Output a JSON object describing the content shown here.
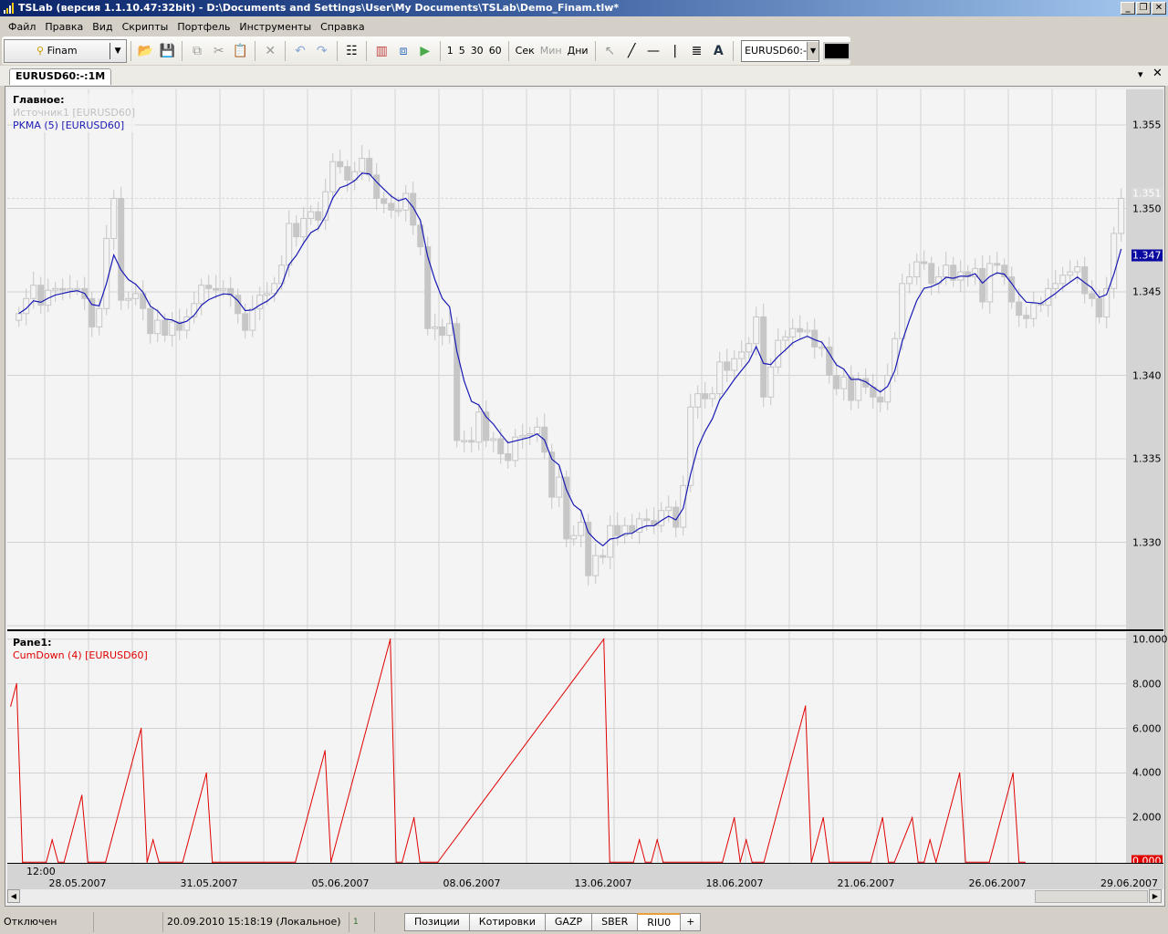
{
  "window": {
    "title": "TSLab (версия 1.1.10.47:32bit) - D:\\Documents and Settings\\User\\My Documents\\TSLab\\Demo_Finam.tlw*"
  },
  "menu": [
    "Файл",
    "Правка",
    "Вид",
    "Скрипты",
    "Портфель",
    "Инструменты",
    "Справка"
  ],
  "toolbar": {
    "provider": "Finam",
    "intervals": [
      "1",
      "5",
      "30",
      "60"
    ],
    "units": [
      "Сек",
      "Мин",
      "Дни"
    ],
    "symbol": "EURUSD60:-",
    "color": "#000000"
  },
  "chart_tab": "EURUSD60:-:1M",
  "main_pane": {
    "title": "Главное:",
    "source_label": "Источник1 [EURUSD60]",
    "indicator_label": "PKMA (5) [EURUSD60]",
    "last_price_label": "1.351",
    "indicator_value_label": "1.347"
  },
  "lower_pane": {
    "title": "Pane1:",
    "indicator_label": "CumDown (4) [EURUSD60]",
    "last_value_label": "0.000"
  },
  "time_axis": {
    "time_label": "12:00",
    "dates": [
      "28.05.2007",
      "31.05.2007",
      "05.06.2007",
      "08.06.2007",
      "13.06.2007",
      "18.06.2007",
      "21.06.2007",
      "26.06.2007",
      "29.06.2007"
    ]
  },
  "colors": {
    "candle": "#c6c6c6",
    "pkma": "#1a1ab4",
    "cumdown": "#e00000",
    "indicator_badge": "#0a0aa0",
    "cumdown_badge": "#e00000"
  },
  "chart_data": [
    {
      "type": "candlestick",
      "name": "Источник1 [EURUSD60]",
      "ylim": [
        1.3255,
        1.3575
      ],
      "yticks": [
        "1.355",
        "1.350",
        "1.345",
        "1.340",
        "1.335",
        "1.330"
      ],
      "ytick_values": [
        1.355,
        1.35,
        1.345,
        1.34,
        1.335,
        1.33
      ],
      "close": [
        1.3437,
        1.3446,
        1.3454,
        1.3442,
        1.3451,
        1.3452,
        1.3451,
        1.3452,
        1.3452,
        1.3446,
        1.3429,
        1.344,
        1.3482,
        1.3506,
        1.3445,
        1.3446,
        1.3449,
        1.344,
        1.3425,
        1.3433,
        1.3424,
        1.3432,
        1.3427,
        1.3435,
        1.3443,
        1.3454,
        1.3452,
        1.3451,
        1.3452,
        1.3448,
        1.3437,
        1.3427,
        1.344,
        1.3448,
        1.3449,
        1.3455,
        1.3466,
        1.3491,
        1.3483,
        1.3494,
        1.3498,
        1.3493,
        1.351,
        1.3528,
        1.3525,
        1.3517,
        1.3522,
        1.353,
        1.352,
        1.3506,
        1.3503,
        1.3499,
        1.3499,
        1.3509,
        1.349,
        1.3477,
        1.3428,
        1.3429,
        1.3424,
        1.3431,
        1.3361,
        1.3361,
        1.336,
        1.3378,
        1.3361,
        1.3362,
        1.3353,
        1.3349,
        1.3363,
        1.3364,
        1.3365,
        1.3369,
        1.3354,
        1.3327,
        1.3339,
        1.3302,
        1.3304,
        1.3312,
        1.328,
        1.3292,
        1.3291,
        1.331,
        1.3304,
        1.331,
        1.3306,
        1.3314,
        1.3313,
        1.331,
        1.3319,
        1.3321,
        1.3309,
        1.3334,
        1.3381,
        1.3389,
        1.3386,
        1.3389,
        1.3408,
        1.3403,
        1.341,
        1.3414,
        1.3419,
        1.3435,
        1.3387,
        1.3405,
        1.3421,
        1.3423,
        1.3428,
        1.3426,
        1.3427,
        1.3417,
        1.3417,
        1.34,
        1.3392,
        1.3399,
        1.3385,
        1.3398,
        1.3393,
        1.3387,
        1.3384,
        1.34,
        1.3422,
        1.3455,
        1.3459,
        1.3468,
        1.3467,
        1.3455,
        1.3459,
        1.3466,
        1.3457,
        1.3462,
        1.3459,
        1.3464,
        1.3444,
        1.3467,
        1.3466,
        1.3459,
        1.3444,
        1.3436,
        1.3434,
        1.3443,
        1.3442,
        1.3452,
        1.3455,
        1.346,
        1.3462,
        1.3465,
        1.3449,
        1.3446,
        1.3435,
        1.3452,
        1.3485,
        1.3506
      ],
      "pkma_period": 5
    },
    {
      "type": "line",
      "name": "CumDown (4) [EURUSD60]",
      "ylim": [
        0,
        10.4
      ],
      "yticks": [
        "10.000",
        "8.000",
        "6.000",
        "4.000",
        "2.000"
      ],
      "ytick_values": [
        10,
        8,
        6,
        4,
        2
      ],
      "points": [
        [
          0,
          7
        ],
        [
          1,
          8
        ],
        [
          2,
          0
        ],
        [
          6,
          0
        ],
        [
          7,
          1
        ],
        [
          8,
          0
        ],
        [
          9,
          0
        ],
        [
          12,
          3
        ],
        [
          13,
          0
        ],
        [
          16,
          0
        ],
        [
          22,
          6
        ],
        [
          23,
          0
        ],
        [
          24,
          1
        ],
        [
          25,
          0
        ],
        [
          29,
          0
        ],
        [
          33,
          4
        ],
        [
          34,
          0
        ],
        [
          48,
          0
        ],
        [
          53,
          5
        ],
        [
          54,
          0
        ],
        [
          64,
          10
        ],
        [
          65,
          0
        ],
        [
          66,
          0
        ],
        [
          68,
          2
        ],
        [
          69,
          0
        ],
        [
          72,
          0
        ],
        [
          100,
          10
        ],
        [
          101,
          0
        ],
        [
          105,
          0
        ],
        [
          106,
          1
        ],
        [
          107,
          0
        ],
        [
          108,
          0
        ],
        [
          109,
          1
        ],
        [
          110,
          0
        ],
        [
          120,
          0
        ],
        [
          122,
          2
        ],
        [
          123,
          0
        ],
        [
          124,
          1
        ],
        [
          125,
          0
        ],
        [
          127,
          0
        ],
        [
          134,
          7
        ],
        [
          135,
          0
        ],
        [
          137,
          2
        ],
        [
          138,
          0
        ],
        [
          145,
          0
        ],
        [
          147,
          2
        ],
        [
          148,
          0
        ],
        [
          149,
          0
        ],
        [
          152,
          2
        ],
        [
          153,
          0
        ],
        [
          154,
          0
        ],
        [
          155,
          1
        ],
        [
          156,
          0
        ],
        [
          160,
          4
        ],
        [
          161,
          0
        ],
        [
          165,
          0
        ],
        [
          169,
          4
        ],
        [
          170,
          0
        ],
        [
          171,
          0
        ]
      ]
    }
  ],
  "status": {
    "connection": "Отключен",
    "datetime": "20.09.2010 15:18:19 (Локальное)",
    "page_icon_label": "1",
    "tabs": [
      "Позиции",
      "Котировки",
      "GAZP",
      "SBER",
      "RIU0"
    ],
    "active_tab": "RIU0",
    "add_tab": "+"
  }
}
